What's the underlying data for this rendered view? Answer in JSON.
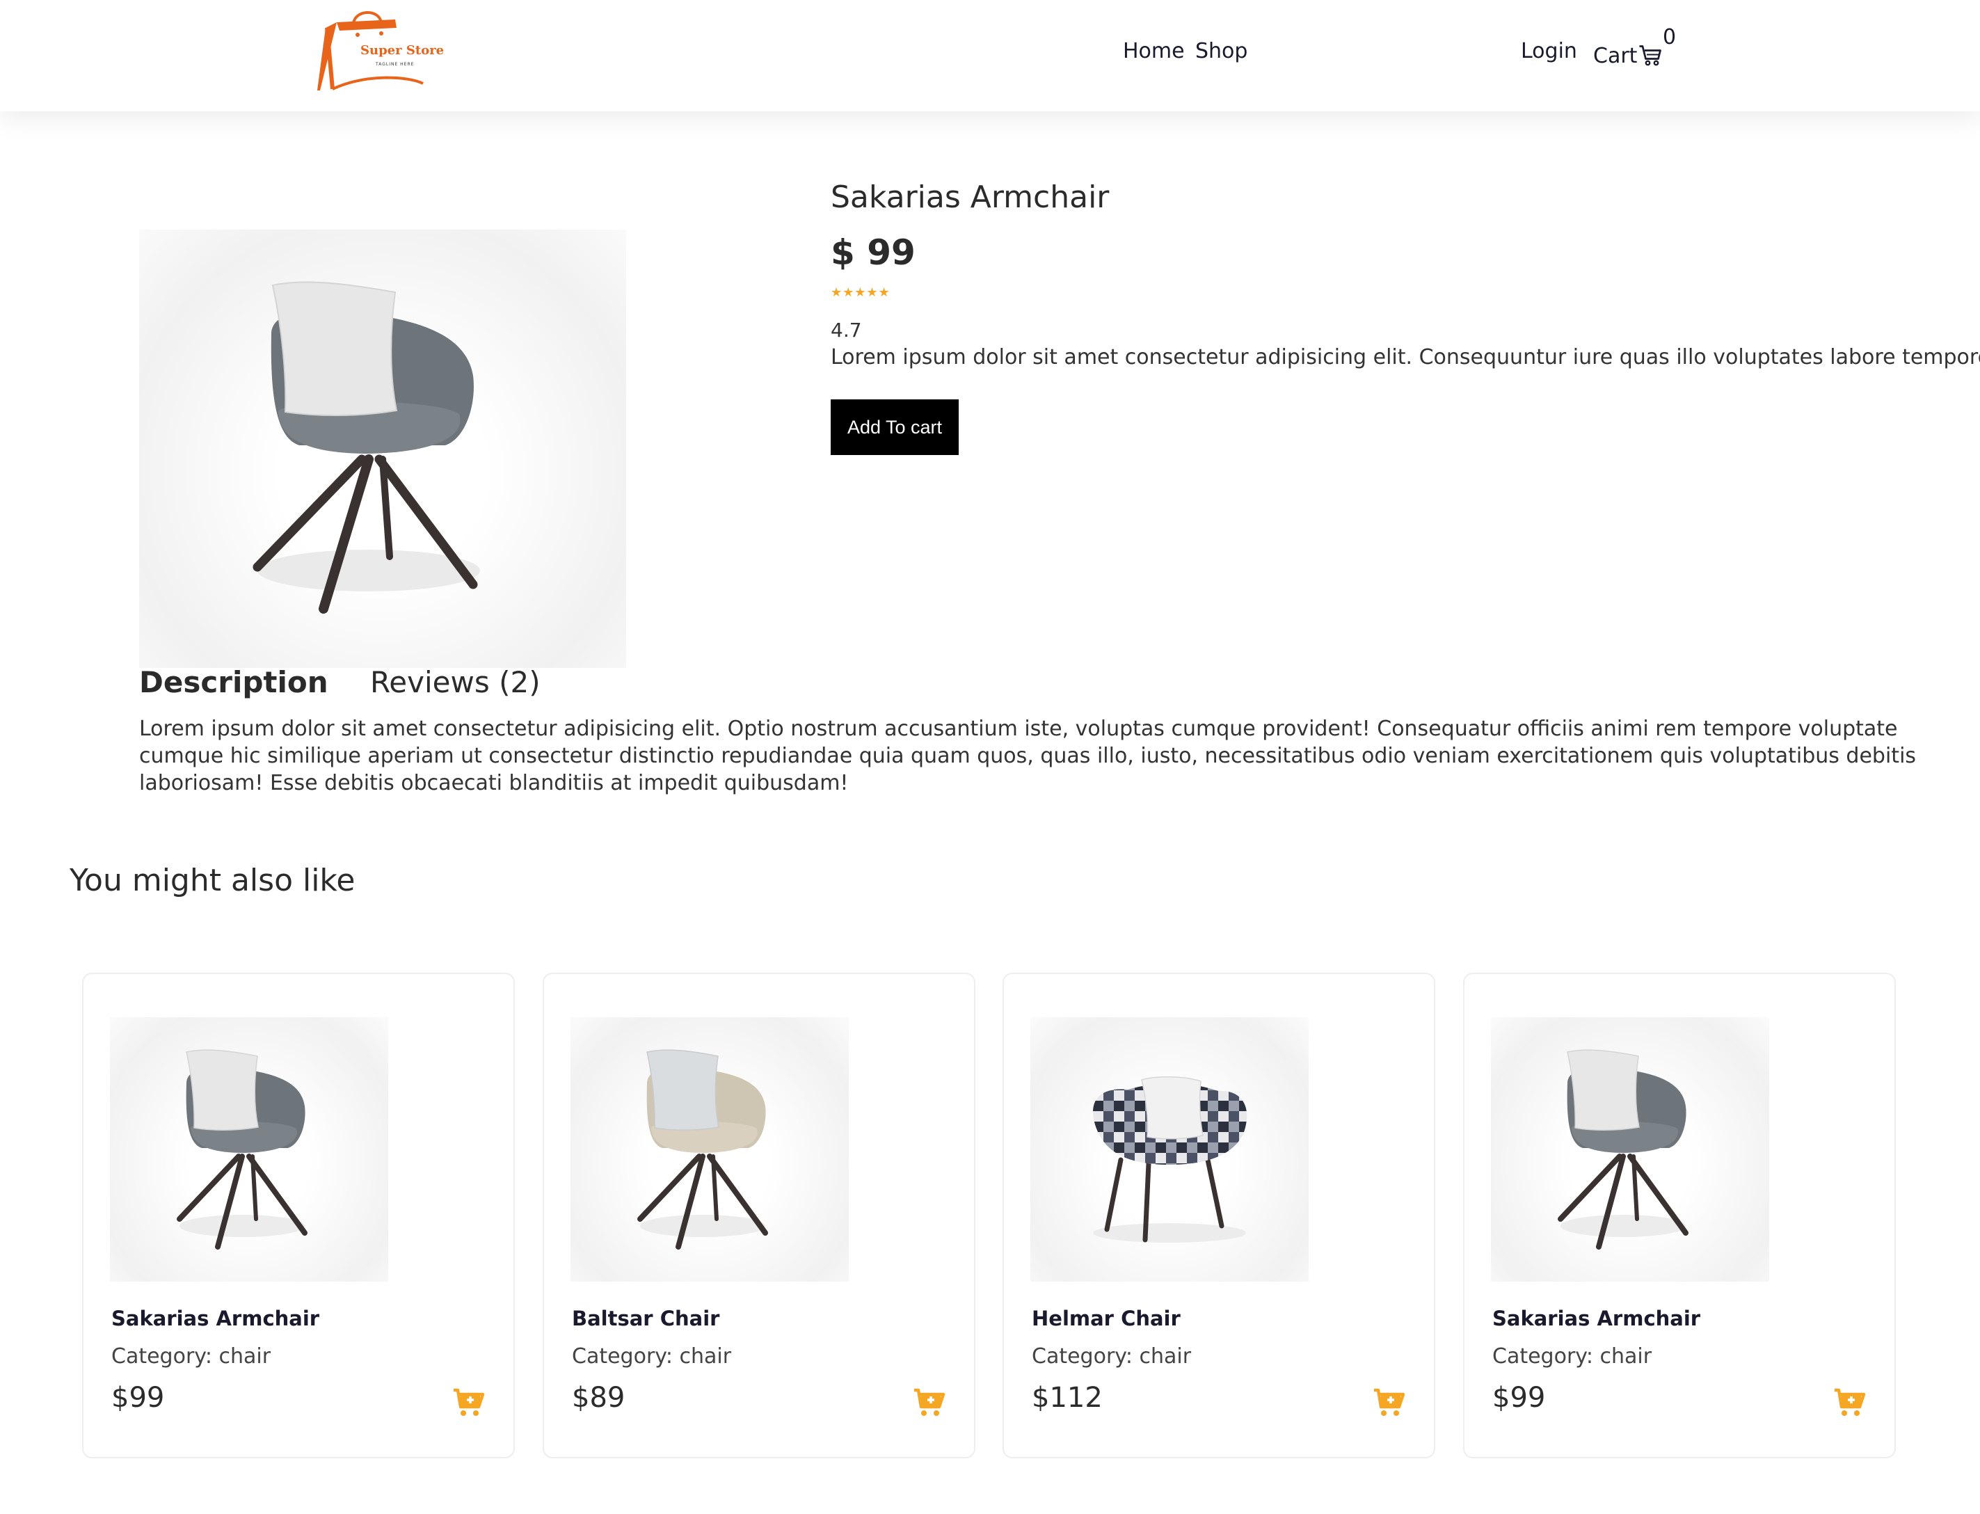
{
  "header": {
    "logo_text": "Super Store",
    "logo_tagline": "TAGLINE HERE",
    "nav": {
      "home": "Home",
      "shop": "Shop",
      "login": "Login",
      "cart": "Cart"
    },
    "cart_count": "0"
  },
  "product": {
    "title": "Sakarias Armchair",
    "price": "$ 99",
    "stars": "★★★★★",
    "rating": "4.7",
    "short_desc": "Lorem ipsum dolor sit amet consectetur adipisicing elit. Consequuntur iure quas illo voluptates labore tempore!",
    "add_to_cart": "Add To cart",
    "upholstery_color": "#6d747a"
  },
  "tabs": {
    "description": "Description",
    "reviews": "Reviews (2)"
  },
  "description_text": "Lorem ipsum dolor sit amet consectetur adipisicing elit. Optio nostrum accusantium iste, voluptas cumque provident! Consequatur officiis animi rem tempore voluptate cumque hic similique aperiam ut consectetur distinctio repudiandae quia quam quos, quas illo, iusto, necessitatibus odio veniam exercitationem quis voluptatibus debitis laboriosam! Esse debitis obcaecati blanditiis at impedit quibusdam!",
  "related": {
    "title": "You might also like",
    "items": [
      {
        "name": "Sakarias Armchair",
        "category": "Category: chair",
        "price": "$99"
      },
      {
        "name": "Baltsar Chair",
        "category": "Category: chair",
        "price": "$89"
      },
      {
        "name": "Helmar Chair",
        "category": "Category: chair",
        "price": "$112"
      },
      {
        "name": "Sakarias Armchair",
        "category": "Category: chair",
        "price": "$99"
      }
    ]
  },
  "colors": {
    "accent": "#f5a623",
    "brand_orange": "#e8641b",
    "button_bg": "#000000"
  },
  "icons": {
    "cart_nav": "cart-icon",
    "card_cart": "add-to-cart-icon"
  }
}
